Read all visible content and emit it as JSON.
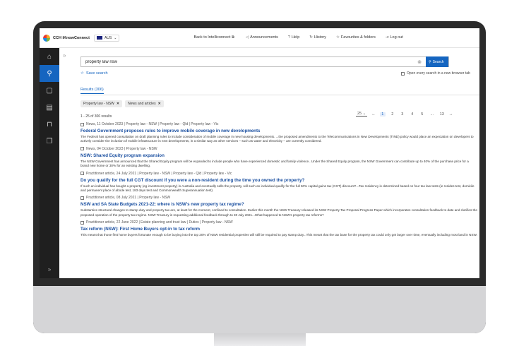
{
  "topbar": {
    "brand": "CCH iKnowConnect",
    "region": "AUS",
    "nav": [
      {
        "icon": "external-link-icon",
        "glyph": "⧉",
        "label": "Back to Intelliconnect"
      },
      {
        "icon": "megaphone-icon",
        "glyph": "◁",
        "label": "Announcements"
      },
      {
        "icon": "help-icon",
        "glyph": "?",
        "label": "Help"
      },
      {
        "icon": "history-icon",
        "glyph": "↻",
        "label": "History"
      },
      {
        "icon": "star-icon",
        "glyph": "☆",
        "label": "Favourites & folders"
      },
      {
        "icon": "logout-icon",
        "glyph": "⇥",
        "label": "Log out"
      }
    ]
  },
  "sidebar": {
    "items": [
      {
        "icon": "home-icon",
        "glyph": "⌂"
      },
      {
        "icon": "search-icon",
        "glyph": "⚲"
      },
      {
        "icon": "briefcase-icon",
        "glyph": "▢"
      },
      {
        "icon": "news-icon",
        "glyph": "▤"
      },
      {
        "icon": "book-icon",
        "glyph": "⊓"
      },
      {
        "icon": "documents-icon",
        "glyph": "❐"
      }
    ],
    "expand_glyph": "»",
    "collapse_glyph": "»"
  },
  "search": {
    "value": "property law nsw",
    "clear_glyph": "⊗",
    "button_label": "Search",
    "save_label": "Save search",
    "newtab_label": "Open every search in a new browser tab"
  },
  "results_tab": "Results (306)",
  "filters": [
    "Property law - NSW",
    "News and articles"
  ],
  "count_text": "1 - 25 of 306 results",
  "pager": {
    "per_page": "25",
    "prev": "←",
    "pages": [
      "1",
      "2",
      "3",
      "4",
      "5",
      "...",
      "13"
    ],
    "current": "1",
    "next": "→"
  },
  "results": [
    {
      "meta": "News, 11 October 2023 | Property law - NSW | Property law - Qld | Property law - Vic",
      "title": "Federal Government proposes rules to improve mobile coverage in new developments",
      "snippet": "The Federal has opened consultation on draft planning rules to include consideration of mobile coverage in new housing developments. ...the proposed amendments to the Telecommunications in New Developments (TIND) policy would place an expectation on developers to actively consider the inclusion of mobile infrastructure in new developments, in a similar way as other services – such as water and electricity – are currently considered."
    },
    {
      "meta": "News, 04 October 2023 | Property law - NSW",
      "title": "NSW: Shared Equity program expansion",
      "snippet": "The NSW Government has announced that the Shared Equity program will be expanded to include people who have experienced domestic and family violence...Under the Shared Equity program, the NSW Government can contribute up to 40% of the purchase price for a brand new home or 30% for an existing dwelling."
    },
    {
      "meta": "Practitioner article, 24 July 2021 | Property law - NSW | Property law - Qld | Property law - Vic",
      "title": "Do you qualify for the full CGT discount if you were a non-resident during the time you owned the property?",
      "snippet": "If such an individual has bought a property (eg investment property) in Australia and eventually sells the property, will such an individual qualify for the full 50% capital gains tax (CGT) discount?...Tax residency is determined based on four tax law tests (ie resides test, domicile and permanent place of abode test, 183 days test and Commonwealth Superannuation test)."
    },
    {
      "meta": "Practitioner article, 08 July 2021 | Property law - NSW",
      "title": "NSW and SA State Budgets 2021-22: where is NSW's new property tax regime?",
      "snippet": "Substantive structural changes to stamp duty and property tax are, at least for the moment, confined to consultation. Earlier this month the NSW Treasury released its NSW Property Tax Proposal Progress Paper which incorporates consultation feedback to date and clarifies the proposed operation of the property tax regime. NSW Treasury is requesting additional feedback through to 30 July 2021...What happened to NSW's property tax reforms?"
    },
    {
      "meta": "Practitioner article, 22 June 2022 | Estate planning and trust law | Duties | Property law - NSW",
      "title": "Tax reform (NSW): First Home Buyers opt-in to tax reform",
      "snippet": "This meant that those first home buyers fortunate enough to be buying into the top 20% of NSW residential properties will still be required to pay stamp duty...This meant that the tax base for the property tax could only get larger over time, eventually including most land in NSW."
    }
  ]
}
